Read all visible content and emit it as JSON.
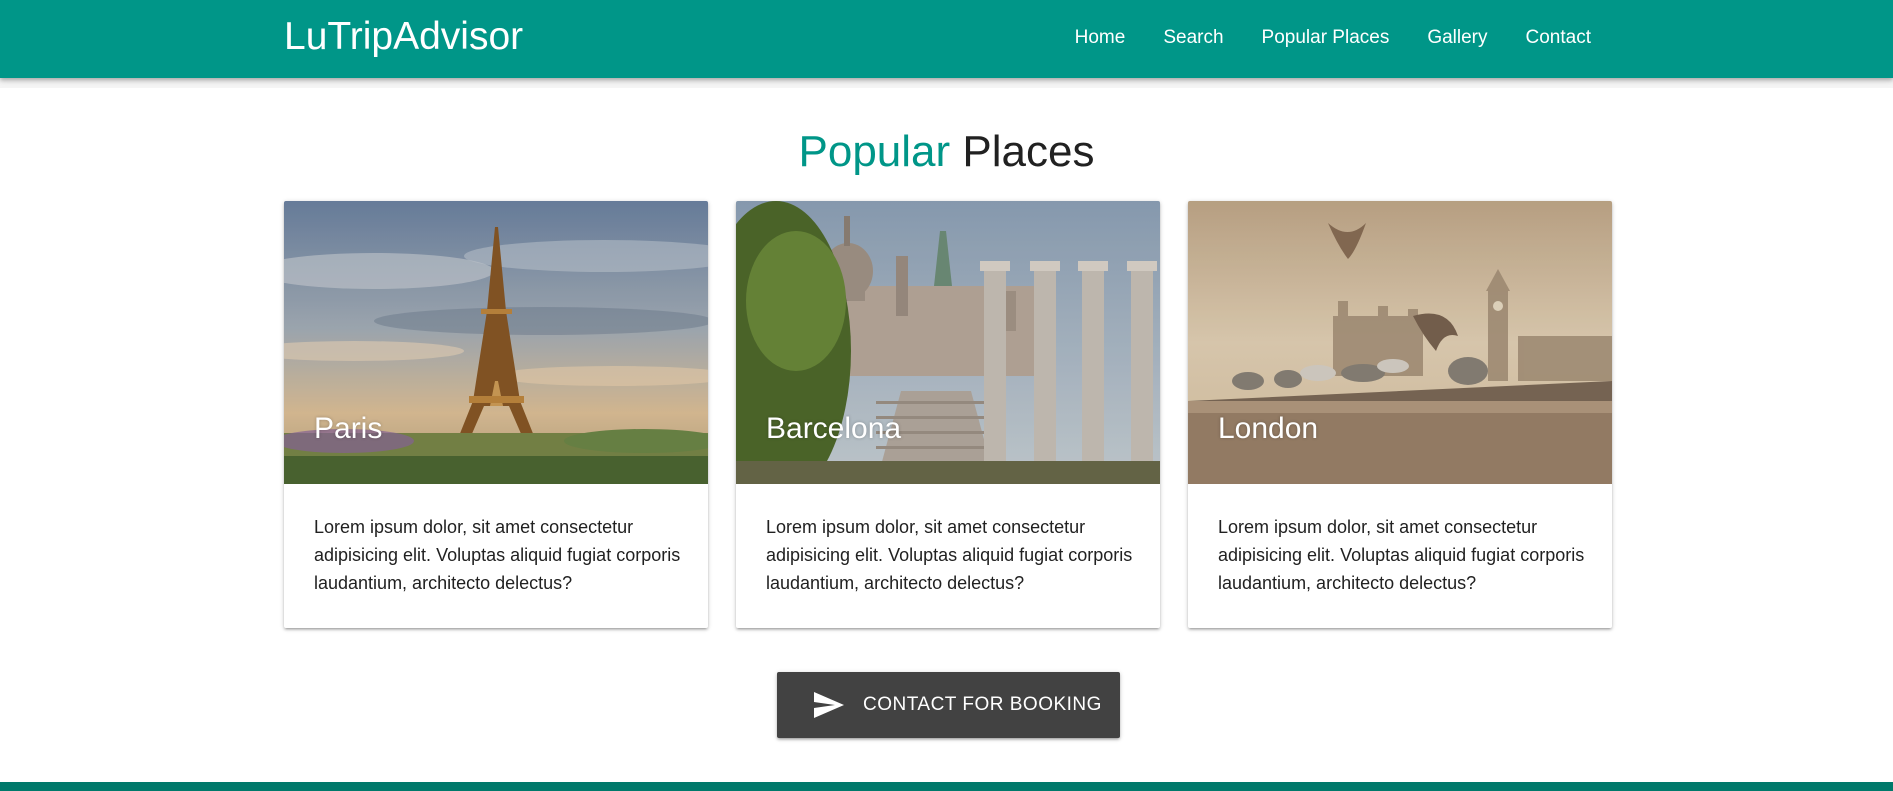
{
  "navbar": {
    "brand": "LuTripAdvisor",
    "links": [
      "Home",
      "Search",
      "Popular Places",
      "Gallery",
      "Contact"
    ],
    "color": "#009688"
  },
  "section": {
    "title_accent": "Popular",
    "title_rest": "Places",
    "accent_color": "#009688"
  },
  "cards": [
    {
      "title": "Paris",
      "image": "eiffel-tower-photo",
      "text": "Lorem ipsum dolor, sit amet consectetur adipisicing elit. Voluptas aliquid fugiat corporis laudantium, architecto delectus?"
    },
    {
      "title": "Barcelona",
      "image": "barcelona-palace-columns-photo",
      "text": "Lorem ipsum dolor, sit amet consectetur adipisicing elit. Voluptas aliquid fugiat corporis laudantium, architecto delectus?"
    },
    {
      "title": "London",
      "image": "london-pigeons-big-ben-photo",
      "text": "Lorem ipsum dolor, sit amet consectetur adipisicing elit. Voluptas aliquid fugiat corporis laudantium, architecto delectus?"
    }
  ],
  "cta": {
    "label": "Contact for Booking",
    "icon": "send-icon",
    "color": "#424242"
  },
  "footer": {
    "color": "#00796b"
  }
}
